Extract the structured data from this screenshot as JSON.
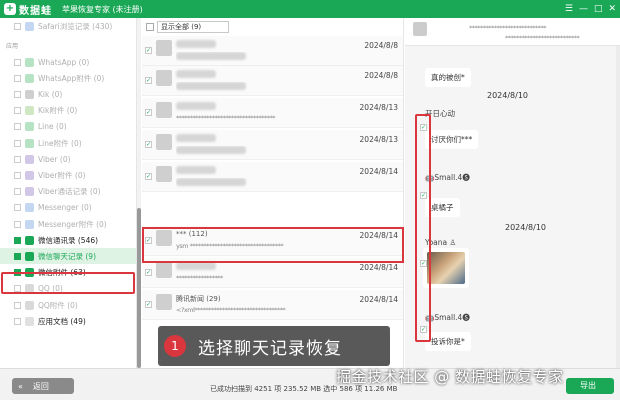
{
  "title_bar": {
    "app_name": "数据蛙",
    "subtitle": "苹果恢复专家 (未注册)",
    "controls": [
      "☰",
      "—",
      "□",
      "✕"
    ]
  },
  "sidebar": {
    "top_item": "Safari浏览记录 (430)",
    "section_label": "应用",
    "items": [
      {
        "label": "WhatsApp (0)",
        "icon_color": "#b5e3c4"
      },
      {
        "label": "WhatsApp附件 (0)",
        "icon_color": "#b5e3c4"
      },
      {
        "label": "Kik (0)",
        "icon_color": "#cfcfcf"
      },
      {
        "label": "Kik附件 (0)",
        "icon_color": "#cfe7c2"
      },
      {
        "label": "Line (0)",
        "icon_color": "#b5e3c4"
      },
      {
        "label": "Line附件 (0)",
        "icon_color": "#b5e3c4"
      },
      {
        "label": "Viber (0)",
        "icon_color": "#d2c7e6"
      },
      {
        "label": "Viber附件 (0)",
        "icon_color": "#d2c7e6"
      },
      {
        "label": "Viber通话记录 (0)",
        "icon_color": "#d2c7e6"
      },
      {
        "label": "Messenger (0)",
        "icon_color": "#c3d6f2"
      },
      {
        "label": "Messenger附件 (0)",
        "icon_color": "#c3d6f2"
      },
      {
        "label": "微信通讯录 (546)",
        "icon_color": "#1aa857"
      },
      {
        "label": "微信聊天记录 (9)",
        "icon_color": "#1aa857"
      },
      {
        "label": "微信附件 (63)",
        "icon_color": "#1aa857"
      },
      {
        "label": "QQ (0)",
        "icon_color": "#d9d9d9"
      },
      {
        "label": "QQ附件 (0)",
        "icon_color": "#d9d9d9"
      },
      {
        "label": "应用文档 (49)",
        "icon_color": "#e0e0e0"
      }
    ]
  },
  "filter": {
    "value": "显示全部 (9)"
  },
  "messages": [
    {
      "date": "2024/8/8",
      "title": "",
      "preview": ""
    },
    {
      "date": "2024/8/8",
      "title": "",
      "preview": ""
    },
    {
      "date": "2024/8/13",
      "title": "",
      "preview": "************************************"
    },
    {
      "date": "2024/8/13",
      "title": "",
      "preview": ""
    },
    {
      "date": "2024/8/14",
      "title": "",
      "preview": ""
    },
    {
      "date": "2024/8/14",
      "title": "*** (112)",
      "preview": "ysm **********************************"
    },
    {
      "date": "2024/8/14",
      "title": "",
      "preview": "*****************"
    },
    {
      "date": "2024/8/14",
      "title": "腾讯新闻 (29)",
      "preview": "<?xml*********************************"
    }
  ],
  "callout": {
    "number": "1",
    "text": "选择聊天记录恢复"
  },
  "chat": {
    "header_line1": "****************************",
    "header_line2": "***************************",
    "bubble_top": "真的被创*",
    "date1": "2024/8/10",
    "sender1": "开日心动",
    "bubble1": "讨厌你们***",
    "sender2": "🤖Small.4🅢",
    "bubble2": "桌橘子",
    "sender3": "Yoana ♙",
    "date2": "2024/8/10",
    "sender4": "🤖Small.4🅢",
    "bubble4": "投诉你是*"
  },
  "footer": {
    "back_label": "返回",
    "status": "已成功扫描到 4251 项 235.52 MB   选中 586 项 11.26 MB",
    "export_label": "导出",
    "watermark": "掘金技术社区 @ 数据蛙恢复专家"
  }
}
